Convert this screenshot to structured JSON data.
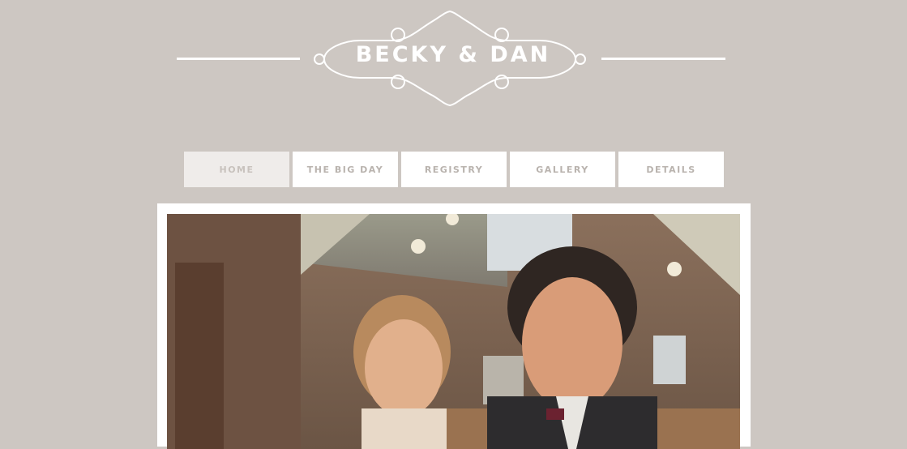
{
  "site": {
    "title": "BECKY & DAN"
  },
  "nav": {
    "items": [
      {
        "label": "HOME",
        "active": true
      },
      {
        "label": "THE BIG DAY",
        "active": false
      },
      {
        "label": "REGISTRY",
        "active": false
      },
      {
        "label": "GALLERY",
        "active": false
      },
      {
        "label": "DETAILS",
        "active": false
      }
    ]
  },
  "colors": {
    "background": "#cdc7c2",
    "nav_text": "#b9b3ae",
    "nav_active_bg": "#efecea"
  },
  "photo": {
    "description_icon": "couple-photo"
  }
}
